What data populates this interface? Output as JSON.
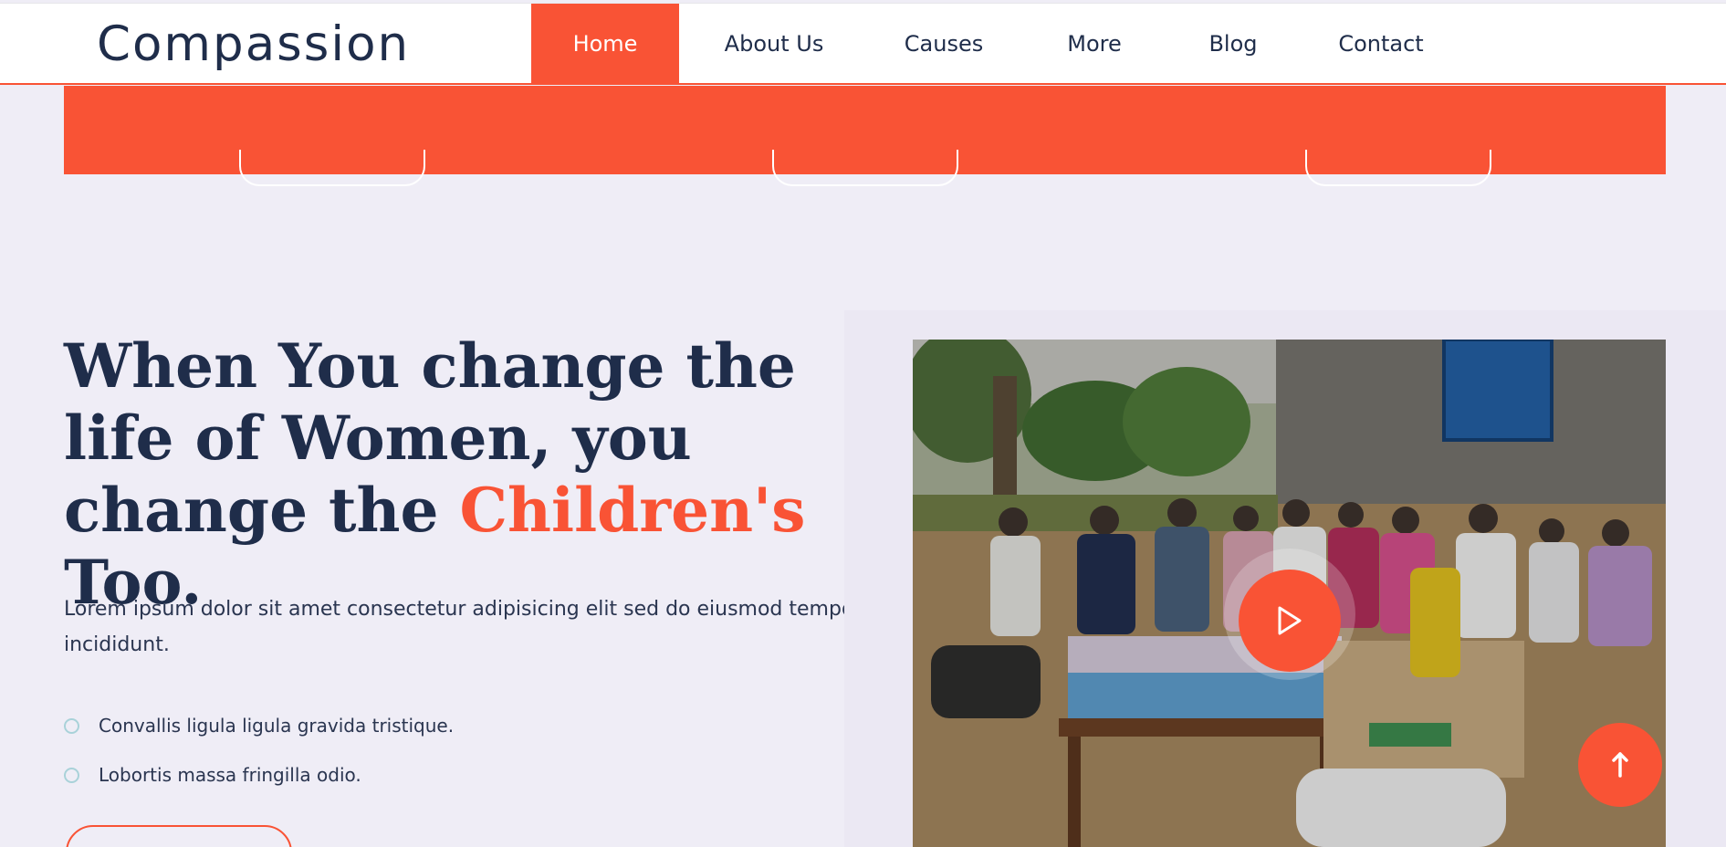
{
  "site": {
    "brand": "Compassion"
  },
  "nav": {
    "items": [
      "Home",
      "About Us",
      "Causes",
      "More",
      "Blog",
      "Contact"
    ],
    "active": "Home"
  },
  "hero": {
    "headline_part1": "When You change the life of Women, you change the",
    "headline_accent": "Children's",
    "headline_part2": "Too.",
    "lead": "Lorem ipsum dolor sit amet consectetur adipisicing elit sed do eiusmod tempor incididunt.",
    "checklist": [
      "Convallis ligula ligula gravida tristique.",
      "Lobortis massa fringilla odio."
    ]
  },
  "icons": {
    "play": "play-icon",
    "to_top": "arrow-up-icon",
    "check": "circle-icon"
  },
  "colors": {
    "accent": "#f95335",
    "text": "#1f2d4a",
    "background": "#efedf6"
  }
}
